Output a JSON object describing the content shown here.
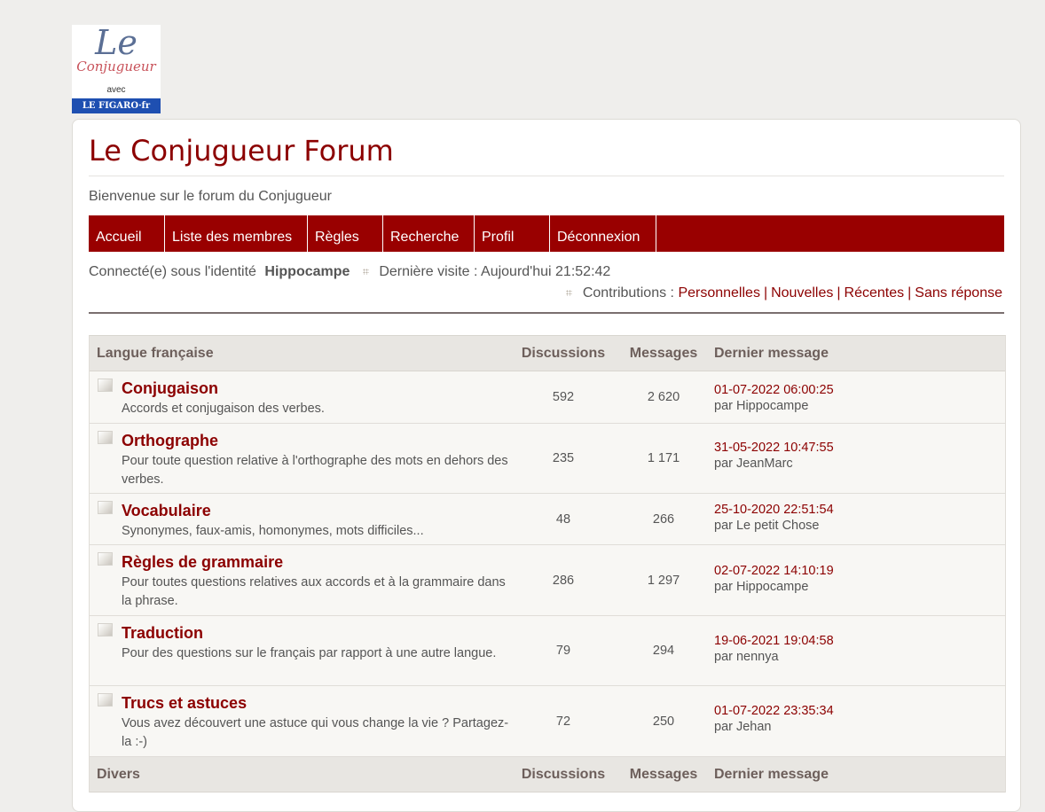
{
  "logo": {
    "line1": "Le",
    "line2": "Conjugueur",
    "line3": "avec",
    "line4": "LE FIGARO·fr"
  },
  "site": {
    "title": "Le Conjugueur Forum",
    "description": "Bienvenue sur le forum du Conjugueur"
  },
  "nav": [
    "Accueil",
    "Liste des membres",
    "Règles",
    "Recherche",
    "Profil",
    "Déconnexion"
  ],
  "status": {
    "logged_in_label": "Connecté(e) sous l'identité",
    "username": "Hippocampe",
    "last_visit": "Dernière visite : Aujourd'hui 21:52:42",
    "contributions_label": "Contributions :",
    "links": [
      "Personnelles",
      "Nouvelles",
      "Récentes",
      "Sans réponse"
    ]
  },
  "categories": [
    {
      "name": "Langue française",
      "col_discussions": "Discussions",
      "col_messages": "Messages",
      "col_last": "Dernier message",
      "forums": [
        {
          "title": "Conjugaison",
          "desc": "Accords et conjugaison des verbes.",
          "discussions": "592",
          "messages": "2 620",
          "last_date": "01-07-2022 06:00:25",
          "last_by": "par Hippocampe"
        },
        {
          "title": "Orthographe",
          "desc": "Pour toute question relative à l'orthographe des mots en dehors des verbes.",
          "discussions": "235",
          "messages": "1 171",
          "last_date": "31-05-2022 10:47:55",
          "last_by": "par JeanMarc"
        },
        {
          "title": "Vocabulaire",
          "desc": "Synonymes, faux-amis, homonymes, mots difficiles...",
          "discussions": "48",
          "messages": "266",
          "last_date": "25-10-2020 22:51:54",
          "last_by": "par Le petit Chose"
        },
        {
          "title": "Règles de grammaire",
          "desc": "Pour toutes questions relatives aux accords et à la grammaire dans la phrase.",
          "discussions": "286",
          "messages": "1 297",
          "last_date": "02-07-2022 14:10:19",
          "last_by": "par Hippocampe"
        },
        {
          "title": "Traduction",
          "desc": "Pour des questions sur le français par rapport à une autre langue.",
          "discussions": "79",
          "messages": "294",
          "last_date": "19-06-2021 19:04:58",
          "last_by": "par nennya"
        },
        {
          "title": "Trucs et astuces",
          "desc": "Vous avez découvert une astuce qui vous change la vie ? Partagez-la :-)",
          "discussions": "72",
          "messages": "250",
          "last_date": "01-07-2022 23:35:34",
          "last_by": "par Jehan"
        }
      ]
    },
    {
      "name": "Divers",
      "col_discussions": "Discussions",
      "col_messages": "Messages",
      "col_last": "Dernier message",
      "forums": []
    }
  ]
}
